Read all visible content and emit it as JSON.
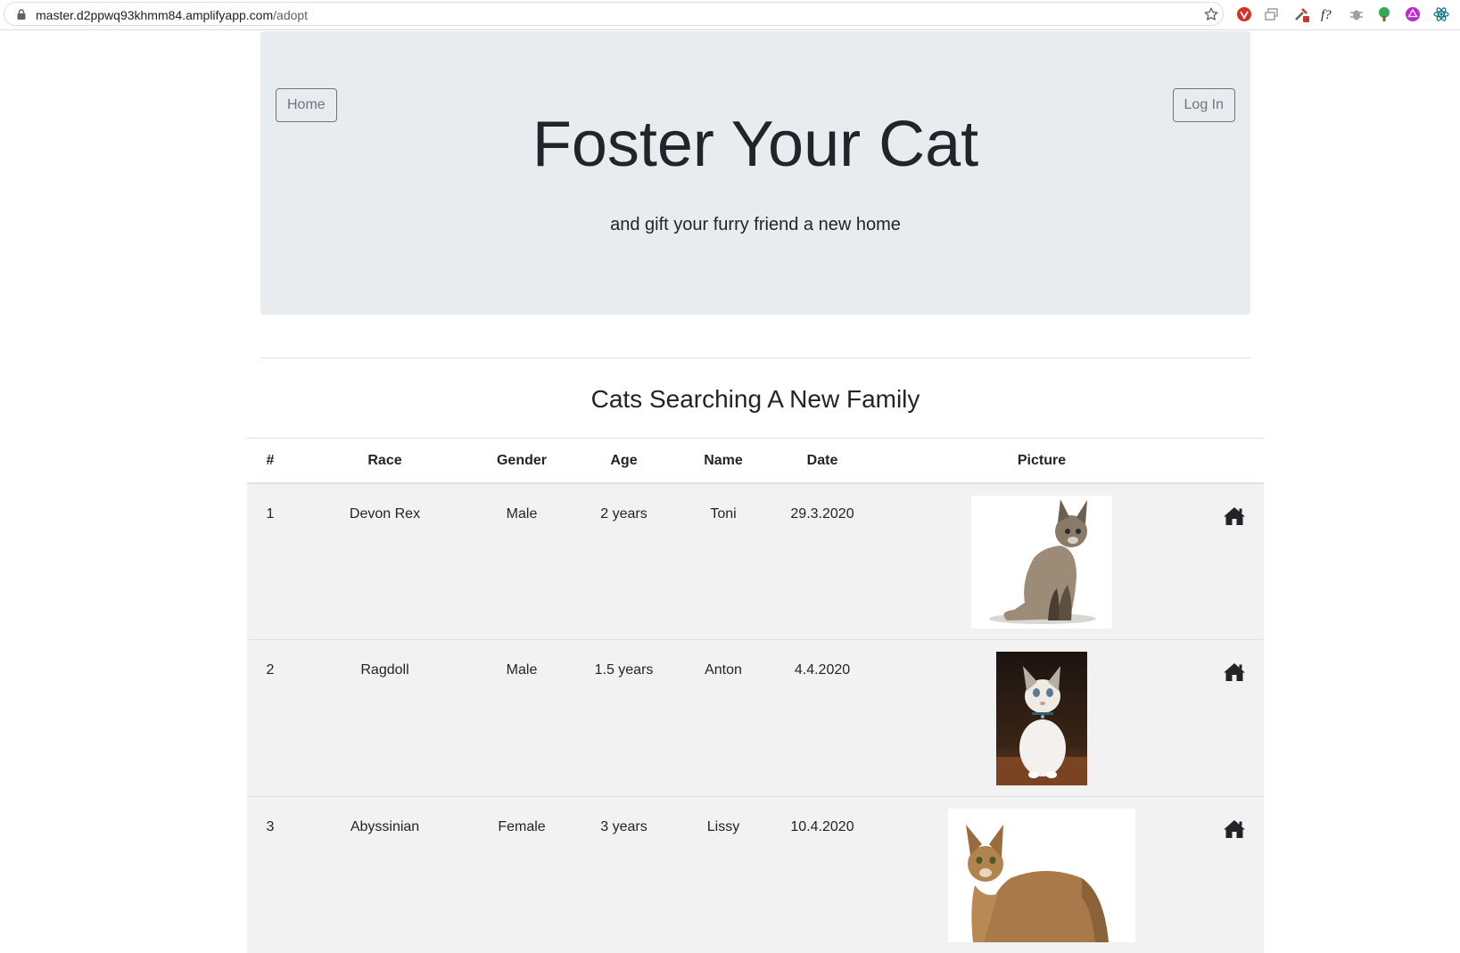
{
  "browser": {
    "url_host": "master.d2ppwq93khmm84.amplifyapp.com",
    "url_path": "/adopt"
  },
  "header": {
    "home_label": "Home",
    "login_label": "Log In",
    "title": "Foster Your Cat",
    "subtitle": "and gift your furry friend a new home"
  },
  "section": {
    "title": "Cats Searching A New Family"
  },
  "table": {
    "columns": [
      "#",
      "Race",
      "Gender",
      "Age",
      "Name",
      "Date",
      "Picture",
      ""
    ],
    "rows": [
      {
        "num": "1",
        "race": "Devon Rex",
        "gender": "Male",
        "age": "2 years",
        "name": "Toni",
        "date": "29.3.2020",
        "photo": "cat-photo-devon-rex"
      },
      {
        "num": "2",
        "race": "Ragdoll",
        "gender": "Male",
        "age": "1.5 years",
        "name": "Anton",
        "date": "4.4.2020",
        "photo": "cat-photo-ragdoll"
      },
      {
        "num": "3",
        "race": "Abyssinian",
        "gender": "Female",
        "age": "3 years",
        "name": "Lissy",
        "date": "10.4.2020",
        "photo": "cat-photo-abyssinian"
      }
    ]
  },
  "icons": {
    "action": "home-icon"
  }
}
